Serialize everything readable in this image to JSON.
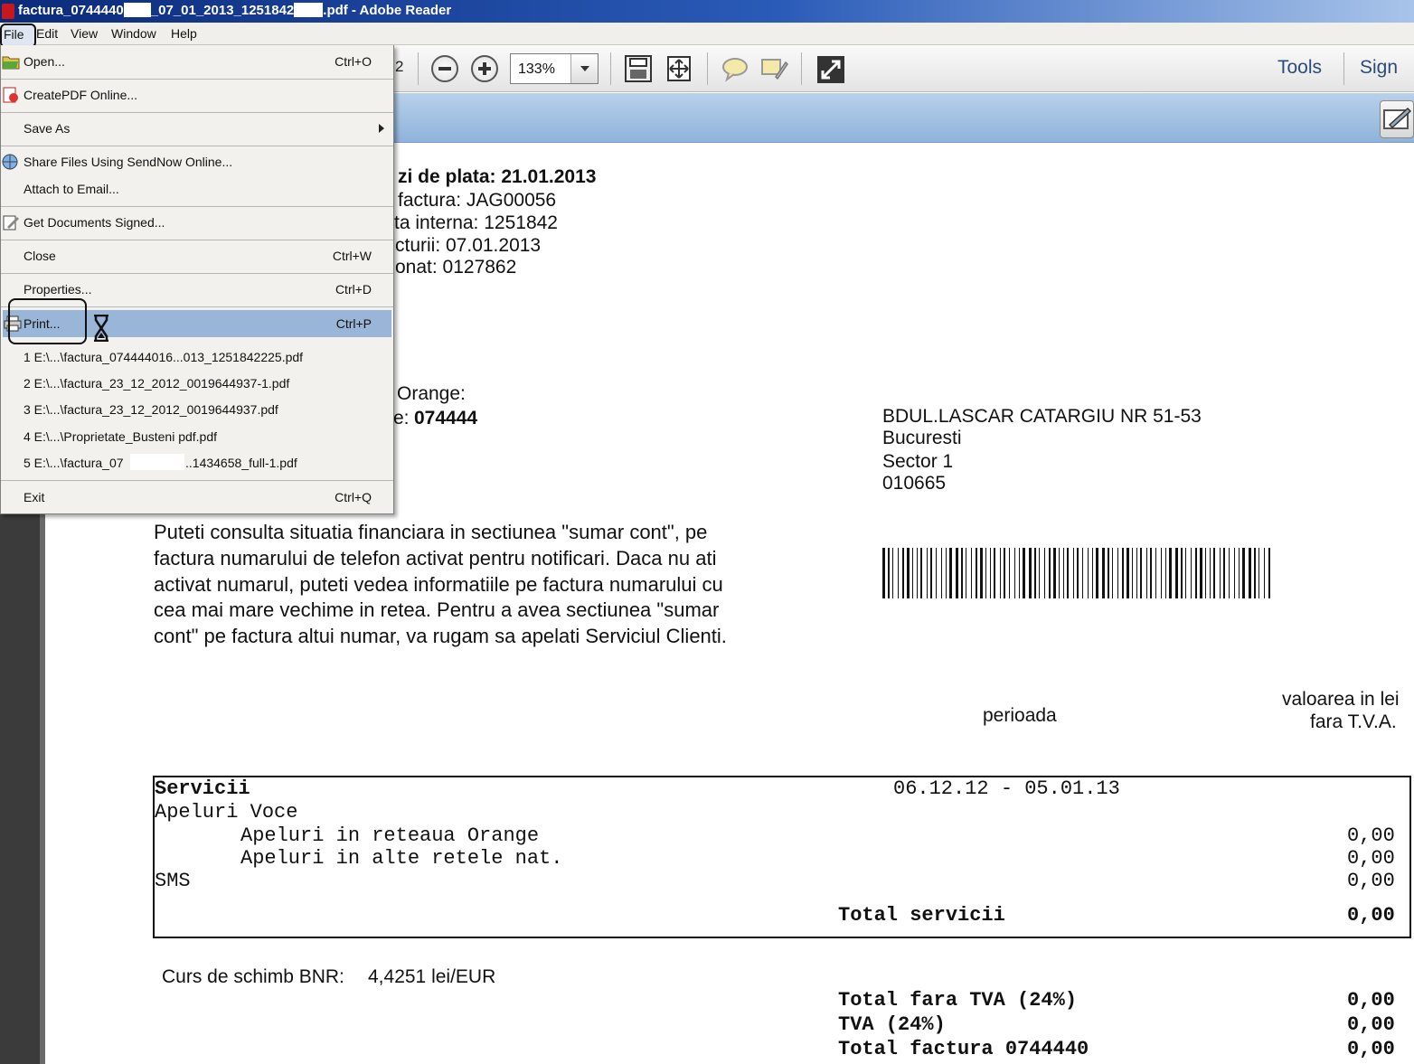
{
  "window": {
    "title_part1": "factura_0744440",
    "title_part2": "_07_01_2013_1251842",
    "title_part3": ".pdf - Adobe Reader"
  },
  "menubar": {
    "items": [
      "File",
      "Edit",
      "View",
      "Window",
      "Help"
    ]
  },
  "toolbar": {
    "page_fragment": "2",
    "zoom": "133%",
    "tools_label": "Tools",
    "sign_label": "Sign"
  },
  "file_menu": {
    "open": {
      "label": "Open...",
      "shortcut": "Ctrl+O"
    },
    "create_pdf": {
      "label": "CreatePDF Online..."
    },
    "save_as": {
      "label": "Save As"
    },
    "share": {
      "label": "Share Files Using SendNow Online..."
    },
    "attach": {
      "label": "Attach to Email..."
    },
    "get_signed": {
      "label": "Get Documents Signed..."
    },
    "close": {
      "label": "Close",
      "shortcut": "Ctrl+W"
    },
    "properties": {
      "label": "Properties...",
      "shortcut": "Ctrl+D"
    },
    "print": {
      "label": "Print...",
      "shortcut": "Ctrl+P"
    },
    "recent": [
      "1 E:\\...\\factura_074444016...013_1251842225.pdf",
      "2 E:\\...\\factura_23_12_2012_0019644937-1.pdf",
      "3 E:\\...\\factura_23_12_2012_0019644937.pdf",
      "4 E:\\...\\Proprietate_Busteni pdf.pdf",
      "5 E:\\...\\factura_07",
      "..1434658_full-1.pdf"
    ],
    "exit": {
      "label": "Exit",
      "shortcut": "Ctrl+Q"
    }
  },
  "document": {
    "header_lines": [
      "zi de plata: 21.01.2013",
      "factura: JAG00056",
      "ta interna: 1251842",
      "cturii: 07.01.2013",
      "onat: 0127862"
    ],
    "orange_label": "Orange:",
    "phone_prefix": "e:",
    "phone_value": "074444",
    "address": [
      "BDUL.LASCAR CATARGIU NR 51-53",
      "Bucuresti",
      "Sector 1",
      "010665"
    ],
    "notice": [
      "Puteti consulta situatia financiara in sectiunea \"sumar cont\", pe",
      "factura numarului de telefon activat pentru notificari. Daca nu ati",
      "activat numarul, puteti vedea informatiile pe factura numarului cu",
      "cea mai mare vechime in retea. Pentru a avea sectiunea \"sumar",
      "cont\" pe factura altui numar, va rugam sa apelati Serviciul Clienti."
    ],
    "perioada_label": "perioada",
    "value_header_1": "valoarea in lei",
    "value_header_2": "fara T.V.A.",
    "services": {
      "title": "Servicii",
      "period": "06.12.12 - 05.01.13",
      "apeluri_voce": "Apeluri Voce",
      "rows": [
        {
          "label": "Apeluri in reteaua Orange",
          "value": "0,00"
        },
        {
          "label": "Apeluri in alte retele nat.",
          "value": "0,00"
        },
        {
          "label": "SMS",
          "value": "0,00"
        }
      ],
      "total_label": "Total servicii",
      "total_value": "0,00"
    },
    "exchange_label": "Curs de schimb BNR:",
    "exchange_value": "4,4251 lei/EUR",
    "totals": [
      {
        "label": "Total fara TVA (24%)",
        "value": "0,00"
      },
      {
        "label": "TVA (24%)",
        "value": "0,00"
      },
      {
        "label": "Total factura 0744440",
        "value": "0,00"
      }
    ]
  }
}
